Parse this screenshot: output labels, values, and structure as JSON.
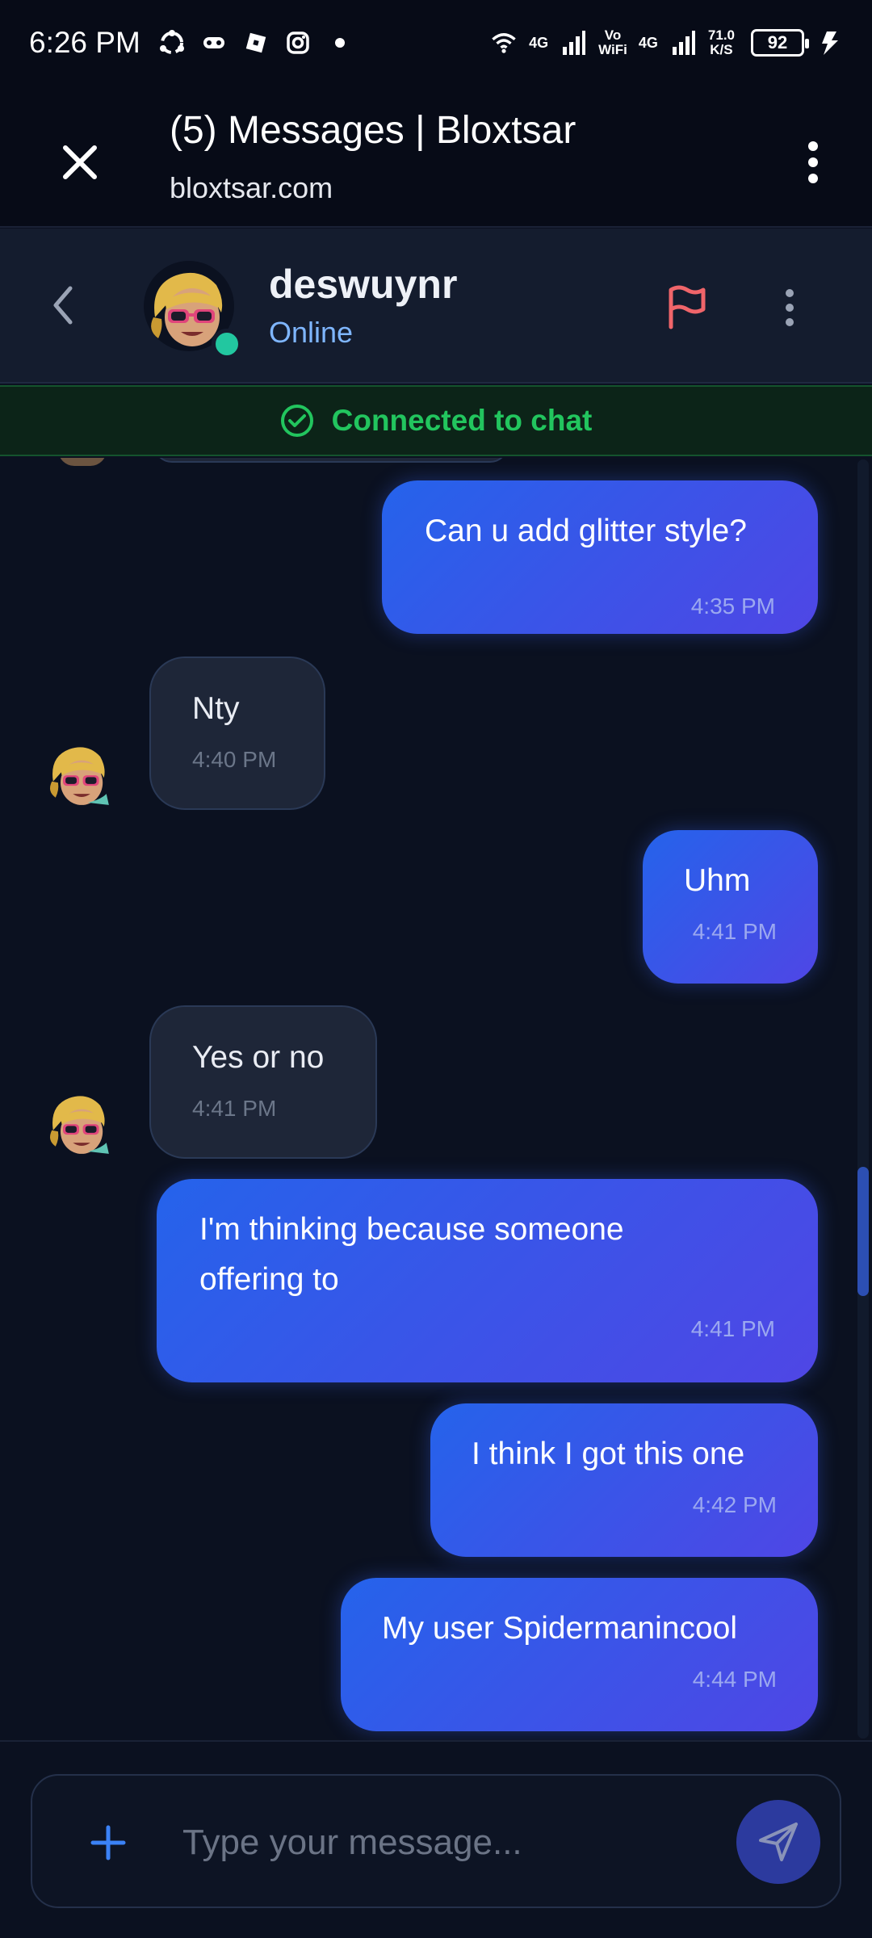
{
  "status_bar": {
    "time": "6:26 PM",
    "network_1": "4G",
    "vowifi_top": "Vo",
    "vowifi_bottom": "WiFi",
    "network_2": "4G",
    "speed_value": "71.0",
    "speed_unit": "K/S",
    "battery": "92"
  },
  "browser": {
    "title": "(5) Messages | Bloxtsar",
    "url": "bloxtsar.com"
  },
  "chat_header": {
    "username": "deswuynr",
    "status": "Online"
  },
  "connection": {
    "label": "Connected to chat"
  },
  "messages": [
    {
      "direction": "out",
      "text": "Can u add glitter style?",
      "time": "4:35 PM"
    },
    {
      "direction": "in",
      "text": "Nty",
      "time": "4:40 PM"
    },
    {
      "direction": "out",
      "text": "Uhm",
      "time": "4:41 PM"
    },
    {
      "direction": "in",
      "text": "Yes or no",
      "time": "4:41 PM"
    },
    {
      "direction": "out",
      "text_line1": "I'm thinking because someone",
      "text_line2": "offering to",
      "time": "4:41 PM"
    },
    {
      "direction": "out",
      "text": "I think I got this one",
      "time": "4:42 PM"
    },
    {
      "direction": "out",
      "text": "My user Spidermanincool",
      "time": "4:44 PM"
    }
  ],
  "composer": {
    "placeholder": "Type your message..."
  },
  "colors": {
    "accent_blue": "#2563eb",
    "accent_indigo": "#4f46e5",
    "online_green": "#22c7a0",
    "connected_green": "#22c55e",
    "flag_red": "#f0656a",
    "background": "#0b1120"
  },
  "icons": {
    "close": "close-icon",
    "menu": "kebab-menu-icon",
    "back": "chevron-left-icon",
    "flag": "flag-icon",
    "check": "check-circle-icon",
    "add": "plus-icon",
    "send": "send-icon"
  }
}
